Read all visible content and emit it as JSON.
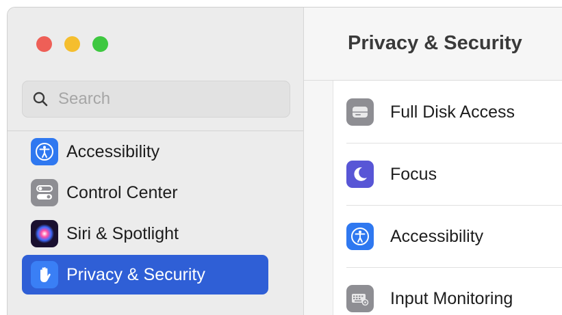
{
  "window": {
    "traffic_lights": {
      "close": "#ee5f57",
      "minimize": "#f5be2e",
      "zoom": "#3ec840"
    }
  },
  "sidebar": {
    "search": {
      "placeholder": "Search",
      "icon": "magnifier-icon"
    },
    "items": [
      {
        "label": "Accessibility",
        "icon": "accessibility-icon",
        "icon_color": "#2f78f0"
      },
      {
        "label": "Control Center",
        "icon": "control-center-icon",
        "icon_color": "#8e8e93"
      },
      {
        "label": "Siri & Spotlight",
        "icon": "siri-icon",
        "icon_color": "#5a2aa0"
      },
      {
        "label": "Privacy & Security",
        "icon": "hand-icon",
        "icon_color": "#3a7ff5",
        "selected": true
      }
    ],
    "selected_color": "#2f5fd6"
  },
  "main": {
    "title": "Privacy & Security",
    "rows": [
      {
        "label": "Full Disk Access",
        "icon": "disk-icon",
        "icon_color": "#8e8e93"
      },
      {
        "label": "Focus",
        "icon": "moon-icon",
        "icon_color": "#5856d6"
      },
      {
        "label": "Accessibility",
        "icon": "accessibility-icon",
        "icon_color": "#2f78f0"
      },
      {
        "label": "Input Monitoring",
        "icon": "keyboard-icon",
        "icon_color": "#8e8e93"
      }
    ]
  }
}
